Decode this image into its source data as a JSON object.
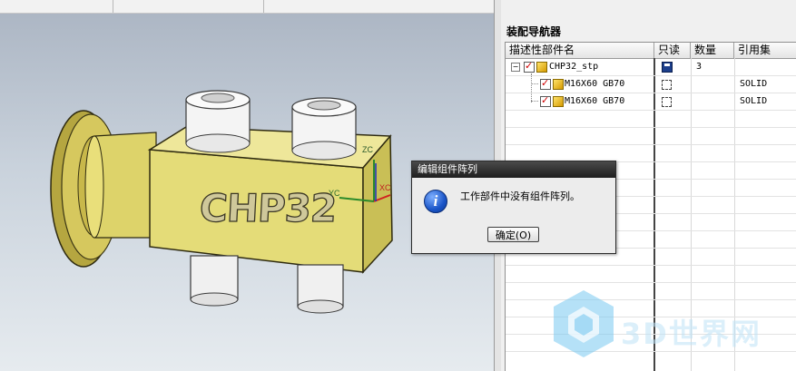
{
  "navigator": {
    "title": "装配导航器",
    "columns": [
      "描述性部件名",
      "只读",
      "数量",
      "引用集"
    ],
    "rows": [
      {
        "name": "CHP32_stp",
        "expander": "−",
        "count": "3",
        "ref_set": "",
        "readonly_icon": "save-disk-icon",
        "level": 0
      },
      {
        "name": "M16X60 GB70",
        "count": "",
        "ref_set": "SOLID",
        "readonly_icon": "dashed-box-icon",
        "level": 1
      },
      {
        "name": "M16X60 GB70",
        "count": "",
        "ref_set": "SOLID",
        "readonly_icon": "dashed-box-icon",
        "level": 1
      }
    ]
  },
  "viewport": {
    "part_label": "CHP32",
    "axes": {
      "z": "ZC",
      "y": "YC",
      "x": "XC"
    }
  },
  "dialog": {
    "title": "编辑组件阵列",
    "message": "工作部件中没有组件阵列。",
    "ok_label": "确定(O)",
    "icon": "info-icon"
  },
  "watermark": {
    "text": "3D世界网"
  },
  "colors": {
    "part_body": "#e4dc78",
    "flange": "#c8b84a",
    "screw": "#f4f4f4",
    "dialog_title": "#2b2b2b",
    "checkbox_check": "#d00000"
  }
}
